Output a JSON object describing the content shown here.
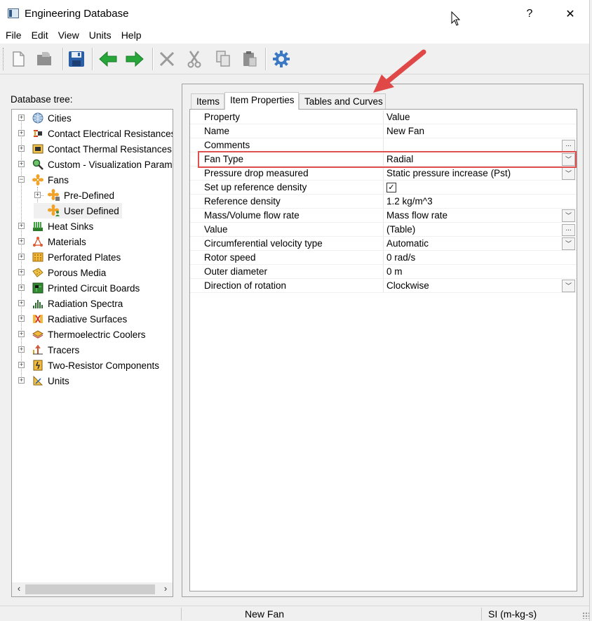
{
  "window": {
    "title": "Engineering Database",
    "help": "?",
    "close": "✕"
  },
  "menu": [
    "File",
    "Edit",
    "View",
    "Units",
    "Help"
  ],
  "toolbar": {
    "buttons": [
      "new-icon",
      "open-folder-icon",
      "save-icon",
      "back-arrow-icon",
      "forward-arrow-icon",
      "delete-icon",
      "cut-icon",
      "copy-icon",
      "paste-icon",
      "settings-gear-icon"
    ]
  },
  "tree": {
    "label": "Database tree:",
    "items": [
      {
        "label": "Cities",
        "icon": "globe-icon",
        "expander": "+"
      },
      {
        "label": "Contact Electrical Resistances",
        "icon": "electrical-contact-icon",
        "expander": "+"
      },
      {
        "label": "Contact Thermal Resistances",
        "icon": "thermal-contact-icon",
        "expander": "+"
      },
      {
        "label": "Custom - Visualization Parameters",
        "icon": "magnifier-icon",
        "expander": "+"
      },
      {
        "label": "Fans",
        "icon": "fan-icon",
        "expander": "−"
      },
      {
        "label": "Pre-Defined",
        "icon": "fan-lock-icon",
        "expander": "+"
      },
      {
        "label": "User Defined",
        "icon": "fan-user-icon",
        "expander": ""
      },
      {
        "label": "Heat Sinks",
        "icon": "heat-sink-icon",
        "expander": "+"
      },
      {
        "label": "Materials",
        "icon": "materials-icon",
        "expander": "+"
      },
      {
        "label": "Perforated Plates",
        "icon": "perforated-plate-icon",
        "expander": "+"
      },
      {
        "label": "Porous Media",
        "icon": "porous-media-icon",
        "expander": "+"
      },
      {
        "label": "Printed Circuit Boards",
        "icon": "pcb-icon",
        "expander": "+"
      },
      {
        "label": "Radiation Spectra",
        "icon": "radiation-spectra-icon",
        "expander": "+"
      },
      {
        "label": "Radiative Surfaces",
        "icon": "radiative-surface-icon",
        "expander": "+"
      },
      {
        "label": "Thermoelectric Coolers",
        "icon": "thermoelectric-cooler-icon",
        "expander": "+"
      },
      {
        "label": "Tracers",
        "icon": "tracer-icon",
        "expander": "+"
      },
      {
        "label": "Two-Resistor Components",
        "icon": "two-resistor-icon",
        "expander": "+"
      },
      {
        "label": "Units",
        "icon": "units-icon",
        "expander": "+"
      }
    ],
    "scroll_left": "‹",
    "scroll_right": "›"
  },
  "tabs": [
    {
      "label": "Items"
    },
    {
      "label": "Item Properties"
    },
    {
      "label": "Tables and Curves"
    }
  ],
  "properties": {
    "header_name": "Property",
    "header_value": "Value",
    "rows": [
      {
        "name": "Name",
        "value": "New Fan",
        "control": "none"
      },
      {
        "name": "Comments",
        "value": "",
        "control": "ellipsis"
      },
      {
        "name": "Fan Type",
        "value": "Radial",
        "control": "dropdown"
      },
      {
        "name": "Pressure drop measured",
        "value": "Static pressure increase (Pst)",
        "control": "dropdown"
      },
      {
        "name": "Set up reference density",
        "value": "",
        "control": "checkbox"
      },
      {
        "name": "Reference density",
        "value": "1.2 kg/m^3",
        "control": "none"
      },
      {
        "name": "Mass/Volume flow rate",
        "value": "Mass flow rate",
        "control": "dropdown"
      },
      {
        "name": "Value",
        "value": "(Table)",
        "control": "ellipsis"
      },
      {
        "name": "Circumferential velocity type",
        "value": "Automatic",
        "control": "dropdown"
      },
      {
        "name": "Rotor speed",
        "value": "0 rad/s",
        "control": "none"
      },
      {
        "name": "Outer diameter",
        "value": "0 m",
        "control": "none"
      },
      {
        "name": "Direction of rotation",
        "value": "Clockwise",
        "control": "dropdown"
      }
    ],
    "checkbox_mark": "✓",
    "ellipsis": "...",
    "dropdown_mark": "﹀"
  },
  "status": {
    "item": "New Fan",
    "units": "SI (m-kg-s)"
  },
  "colors": {
    "highlight": "#e05050",
    "arrow": "#e04848"
  }
}
